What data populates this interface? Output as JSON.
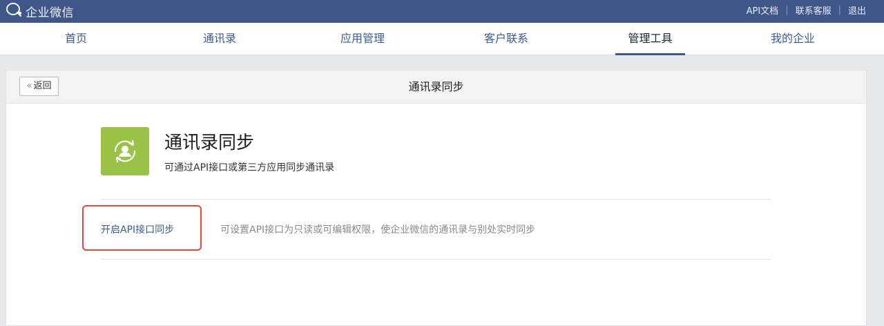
{
  "app": {
    "logo_text": "企业微信"
  },
  "top_links": [
    "API文档",
    "联系客服",
    "退出"
  ],
  "nav": {
    "items": [
      "首页",
      "通讯录",
      "应用管理",
      "客户联系",
      "管理工具",
      "我的企业"
    ],
    "active": "管理工具"
  },
  "panel": {
    "back_label": "返回",
    "back_chevron": "«",
    "title": "通讯录同步"
  },
  "feature": {
    "icon": "contact-sync-icon",
    "icon_color": "#99c247",
    "title": "通讯录同步",
    "description": "可通过API接口或第三方应用同步通讯录",
    "action_label": "开启API接口同步",
    "action_description": "可设置API接口为只读或可编辑权限，使企业微信的通讯录与别处实时同步"
  },
  "colors": {
    "topbar": "#3f5688",
    "nav_text": "#3d5b8e",
    "highlight": "#e0483b"
  }
}
